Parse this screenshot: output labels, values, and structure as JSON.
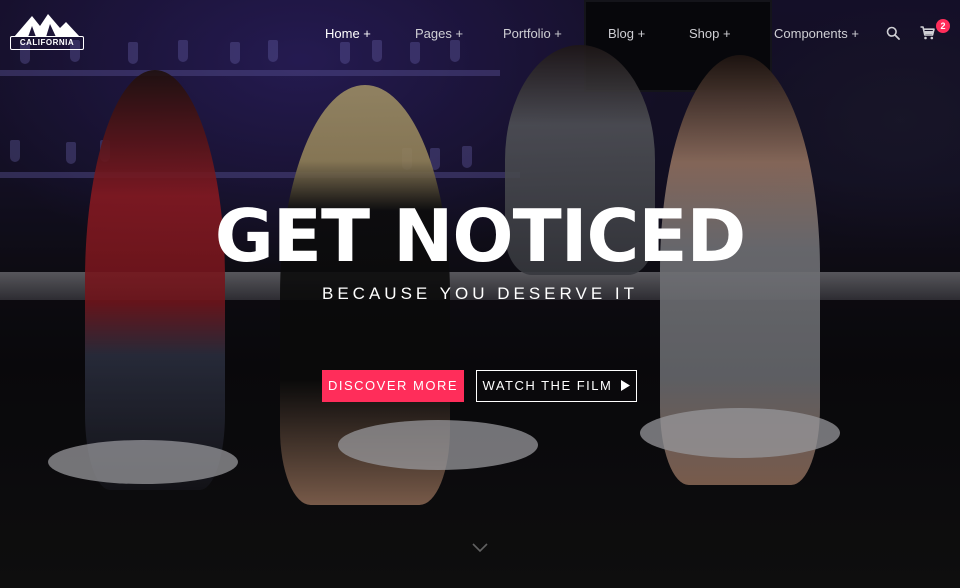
{
  "brand": {
    "logo_text": "CALIFORNIA"
  },
  "nav": {
    "items": [
      {
        "label": "Home +"
      },
      {
        "label": "Pages +"
      },
      {
        "label": "Portfolio +"
      },
      {
        "label": "Blog +"
      },
      {
        "label": "Shop +"
      },
      {
        "label": "Components +"
      }
    ],
    "search_icon": "search-icon",
    "cart_icon": "cart-icon",
    "cart_count": "2"
  },
  "hero": {
    "headline": "GET NOTICED",
    "subline": "BECAUSE YOU DESERVE IT",
    "primary_button": "DISCOVER MORE",
    "secondary_button": "WATCH THE FILM",
    "secondary_button_icon": "play-icon",
    "scroll_icon": "chevron-down-icon"
  },
  "colors": {
    "accent": "#ff2d5a",
    "text": "#ffffff"
  }
}
